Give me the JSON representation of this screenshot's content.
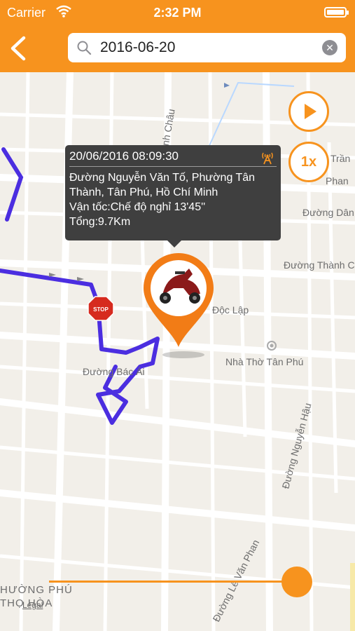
{
  "status_bar": {
    "carrier": "Carrier",
    "time": "2:32 PM"
  },
  "header": {
    "search_value": "2016-06-20"
  },
  "map": {
    "streets": {
      "minh_chau": "Minh Châu",
      "tran": "Trần",
      "phan": "Phan",
      "duong_dan": "Đường Dân",
      "duong_thanh_c": "Đường Thành C",
      "doc_lap": "Độc Lập",
      "nha_tho": "Nhà Thờ Tân Phú",
      "bac_ai": "Đường Bác Ái",
      "nguyen_hau": "Đường Nguyễn Hậu",
      "le_van_phan": "Đường Lê Văn Phan",
      "phuong_phu_1": "HƯỜNG PHÚ",
      "phuong_phu_2": "THỌ HÒA"
    },
    "stop_sign": "STOP",
    "legal": "Legal"
  },
  "popup": {
    "datetime": "20/06/2016 08:09:30",
    "address_line1": "Đường Nguyễn Văn Tố, Phường Tân",
    "address_line2": "Thành, Tân Phú, Hồ Chí Minh",
    "speed": "Vận tốc:Chế độ nghỉ 13'45''",
    "total": "Tổng:9.7Km"
  },
  "controls": {
    "speed_label": "1x"
  },
  "colors": {
    "accent": "#f7931e",
    "route": "#4b2ee0",
    "popup_bg": "#3f3f3f"
  }
}
